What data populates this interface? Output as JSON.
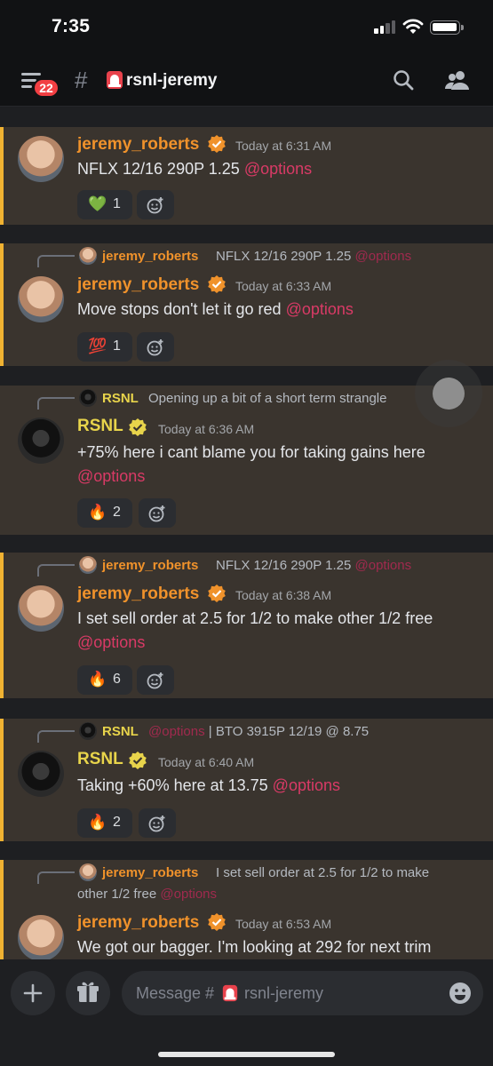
{
  "status_bar": {
    "time": "7:35"
  },
  "header": {
    "notification_count": "22",
    "channel_name": "rsnl-jeremy"
  },
  "messages": [
    {
      "author": "jeremy_roberts",
      "timestamp": "Today at 6:31 AM",
      "text": "NFLX 12/16 290P 1.25",
      "mention": "@options",
      "reaction": {
        "emoji": "💚",
        "count": "1"
      }
    },
    {
      "reply": {
        "author": "jeremy_roberts",
        "text": "NFLX 12/16 290P 1.25",
        "mention": "@options"
      },
      "author": "jeremy_roberts",
      "timestamp": "Today at 6:33 AM",
      "text": "Move stops don't let it go red",
      "mention": "@options",
      "reaction": {
        "emoji": "💯",
        "count": "1"
      }
    },
    {
      "reply": {
        "author": "RSNL",
        "text": "Opening up a bit of a short term strangle"
      },
      "author": "RSNL",
      "timestamp": "Today at 6:36 AM",
      "text": "+75% here i cant blame you for taking gains here",
      "mention": "@options",
      "reaction": {
        "emoji": "🔥",
        "count": "2"
      }
    },
    {
      "reply": {
        "author": "jeremy_roberts",
        "text": "NFLX 12/16 290P 1.25",
        "mention": "@options"
      },
      "author": "jeremy_roberts",
      "timestamp": "Today at 6:38 AM",
      "text": "I set sell order at 2.5 for 1/2 to make other 1/2 free",
      "mention": "@options",
      "reaction": {
        "emoji": "🔥",
        "count": "6"
      }
    },
    {
      "reply": {
        "author": "RSNL",
        "mention": "@options",
        "text": "| BTO 3915P 12/19 @ 8.75"
      },
      "author": "RSNL",
      "timestamp": "Today at 6:40 AM",
      "text": "Taking +60% here at 13.75",
      "mention": "@options",
      "reaction": {
        "emoji": "🔥",
        "count": "2"
      }
    },
    {
      "reply": {
        "author": "jeremy_roberts",
        "text": "I set sell order at 2.5 for 1/2 to make",
        "text2": "other 1/2 free",
        "mention": "@options"
      },
      "author": "jeremy_roberts",
      "timestamp": "Today at 6:53 AM",
      "text": "We got our bagger.  I'm looking at 292 for next trim"
    }
  ],
  "composer": {
    "placeholder": "Message #",
    "channel": "rsnl-jeremy"
  },
  "colors": {
    "accent_orange": "#f0b232",
    "mention": "#d93a66",
    "jr_name": "#f0922b",
    "rsnl_name": "#e8d44b",
    "background": "#1e1f22"
  },
  "icons": [
    "menu-icon",
    "hash-icon",
    "siren-icon",
    "search-icon",
    "members-icon",
    "verified-icon",
    "add-reaction-icon",
    "plus-icon",
    "gift-icon",
    "emoji-icon"
  ]
}
